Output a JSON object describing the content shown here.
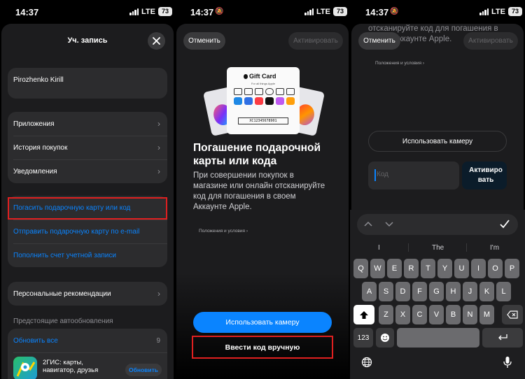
{
  "status": {
    "time": "14:37",
    "network": "LTE",
    "battery": "73"
  },
  "account": {
    "title": "Уч. запись",
    "user_name": "Pirozhenko Kirill",
    "menu": [
      "Приложения",
      "История покупок",
      "Уведомления"
    ],
    "links": [
      "Погасить подарочную карту или код",
      "Отправить подарочную карту по e-mail",
      "Пополнить счет учетной записи"
    ],
    "recommendations": "Персональные рекомендации",
    "auto_updates_header": "Предстоящие автообновления",
    "update_all": "Обновить все",
    "update_count": "9",
    "app_name": "2ГИС: карты, навигатор, друзья",
    "update_button": "Обновить"
  },
  "redeem": {
    "cancel": "Отменить",
    "activate": "Активировать",
    "gift_card_brand": "Gift Card",
    "gift_card_sub": "For all things Apple",
    "gift_card_code": "XC12345678901",
    "headline": "Погашение подарочной карты или кода",
    "description": "При совершении покупок в магазине или онлайн отсканируйте код для погашения в своем Аккаунте Apple.",
    "terms": "Положения и условия ›",
    "use_camera": "Использовать камеру",
    "enter_manually": "Ввести код вручную"
  },
  "manual": {
    "cancel": "Отменить",
    "activate": "Активировать",
    "scrolled_text": "отсканируйте код для погашения в своем Аккаунте Apple.",
    "terms": "Положения и условия ›",
    "use_camera": "Использовать камеру",
    "code_placeholder": "Код",
    "activate_button": "Активировать"
  },
  "keyboard": {
    "suggestions": [
      "I",
      "The",
      "I'm"
    ],
    "row1": [
      "Q",
      "W",
      "E",
      "R",
      "T",
      "Y",
      "U",
      "I",
      "O",
      "P"
    ],
    "row2": [
      "A",
      "S",
      "D",
      "F",
      "G",
      "H",
      "J",
      "K",
      "L"
    ],
    "row3": [
      "Z",
      "X",
      "C",
      "V",
      "B",
      "N",
      "M"
    ],
    "numbers_key": "123"
  },
  "colors": {
    "accent": "#0a84ff",
    "highlight": "#e02020",
    "sheet": "#1c1c1e",
    "cell": "#2c2c2e"
  }
}
